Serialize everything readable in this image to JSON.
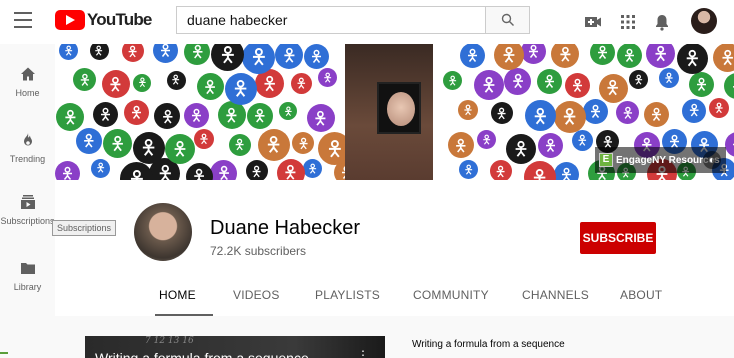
{
  "header": {
    "logo_text": "YouTube",
    "search_value": "duane habecker"
  },
  "sidebar": {
    "items": [
      {
        "label": "Home"
      },
      {
        "label": "Trending"
      },
      {
        "label": "Subscriptions"
      },
      {
        "label": "Library"
      }
    ],
    "tooltip": "Subscriptions"
  },
  "banner": {
    "link_text": "EngageNY Resources",
    "link_logo": "E"
  },
  "channel": {
    "name": "Duane Habecker",
    "subscribers": "72.2K subscribers",
    "subscribe_label": "SUBSCRIBE"
  },
  "tabs": [
    {
      "label": "HOME"
    },
    {
      "label": "VIDEOS"
    },
    {
      "label": "PLAYLISTS"
    },
    {
      "label": "COMMUNITY"
    },
    {
      "label": "CHANNELS"
    },
    {
      "label": "ABOUT"
    }
  ],
  "featured": {
    "thumb_text": "Writing a formula from a sequence",
    "scribble": "7 12 13 16",
    "title": "Writing a formula from a sequence"
  },
  "colors": {
    "brand_red": "#ff0000",
    "subscribe_red": "#cc0000",
    "banner_purple": "#8a3fc7",
    "banner_blue": "#2f6fd6",
    "banner_green": "#2e9d3e",
    "banner_orange": "#c9783a",
    "banner_red": "#d23a3a",
    "banner_black": "#1a1a1a"
  }
}
